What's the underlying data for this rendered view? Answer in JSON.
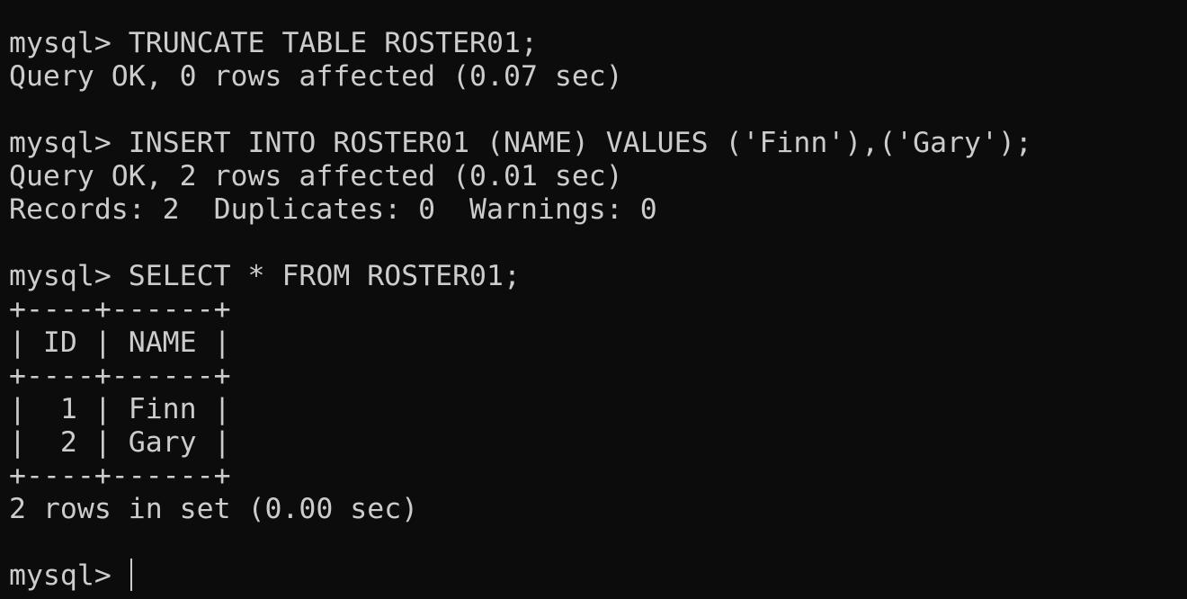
{
  "terminal": {
    "lines": [
      {
        "kind": "command",
        "prompt": "mysql> ",
        "text": "TRUNCATE TABLE ROSTER01;"
      },
      {
        "kind": "output",
        "text": "Query OK, 0 rows affected (0.07 sec)"
      },
      {
        "kind": "blank",
        "text": ""
      },
      {
        "kind": "command",
        "prompt": "mysql> ",
        "text": "INSERT INTO ROSTER01 (NAME) VALUES ('Finn'),('Gary');"
      },
      {
        "kind": "output",
        "text": "Query OK, 2 rows affected (0.01 sec)"
      },
      {
        "kind": "output",
        "text": "Records: 2  Duplicates: 0  Warnings: 0"
      },
      {
        "kind": "blank",
        "text": ""
      },
      {
        "kind": "command",
        "prompt": "mysql> ",
        "text": "SELECT * FROM ROSTER01;"
      },
      {
        "kind": "table",
        "text": "+----+------+"
      },
      {
        "kind": "table",
        "text": "| ID | NAME |"
      },
      {
        "kind": "table",
        "text": "+----+------+"
      },
      {
        "kind": "table",
        "text": "|  1 | Finn |"
      },
      {
        "kind": "table",
        "text": "|  2 | Gary |"
      },
      {
        "kind": "table",
        "text": "+----+------+"
      },
      {
        "kind": "output",
        "text": "2 rows in set (0.00 sec)"
      },
      {
        "kind": "blank",
        "text": ""
      },
      {
        "kind": "input",
        "prompt": "mysql> ",
        "text": ""
      }
    ],
    "colors": {
      "background": "#0c0c0c",
      "foreground": "#cccccc"
    }
  }
}
